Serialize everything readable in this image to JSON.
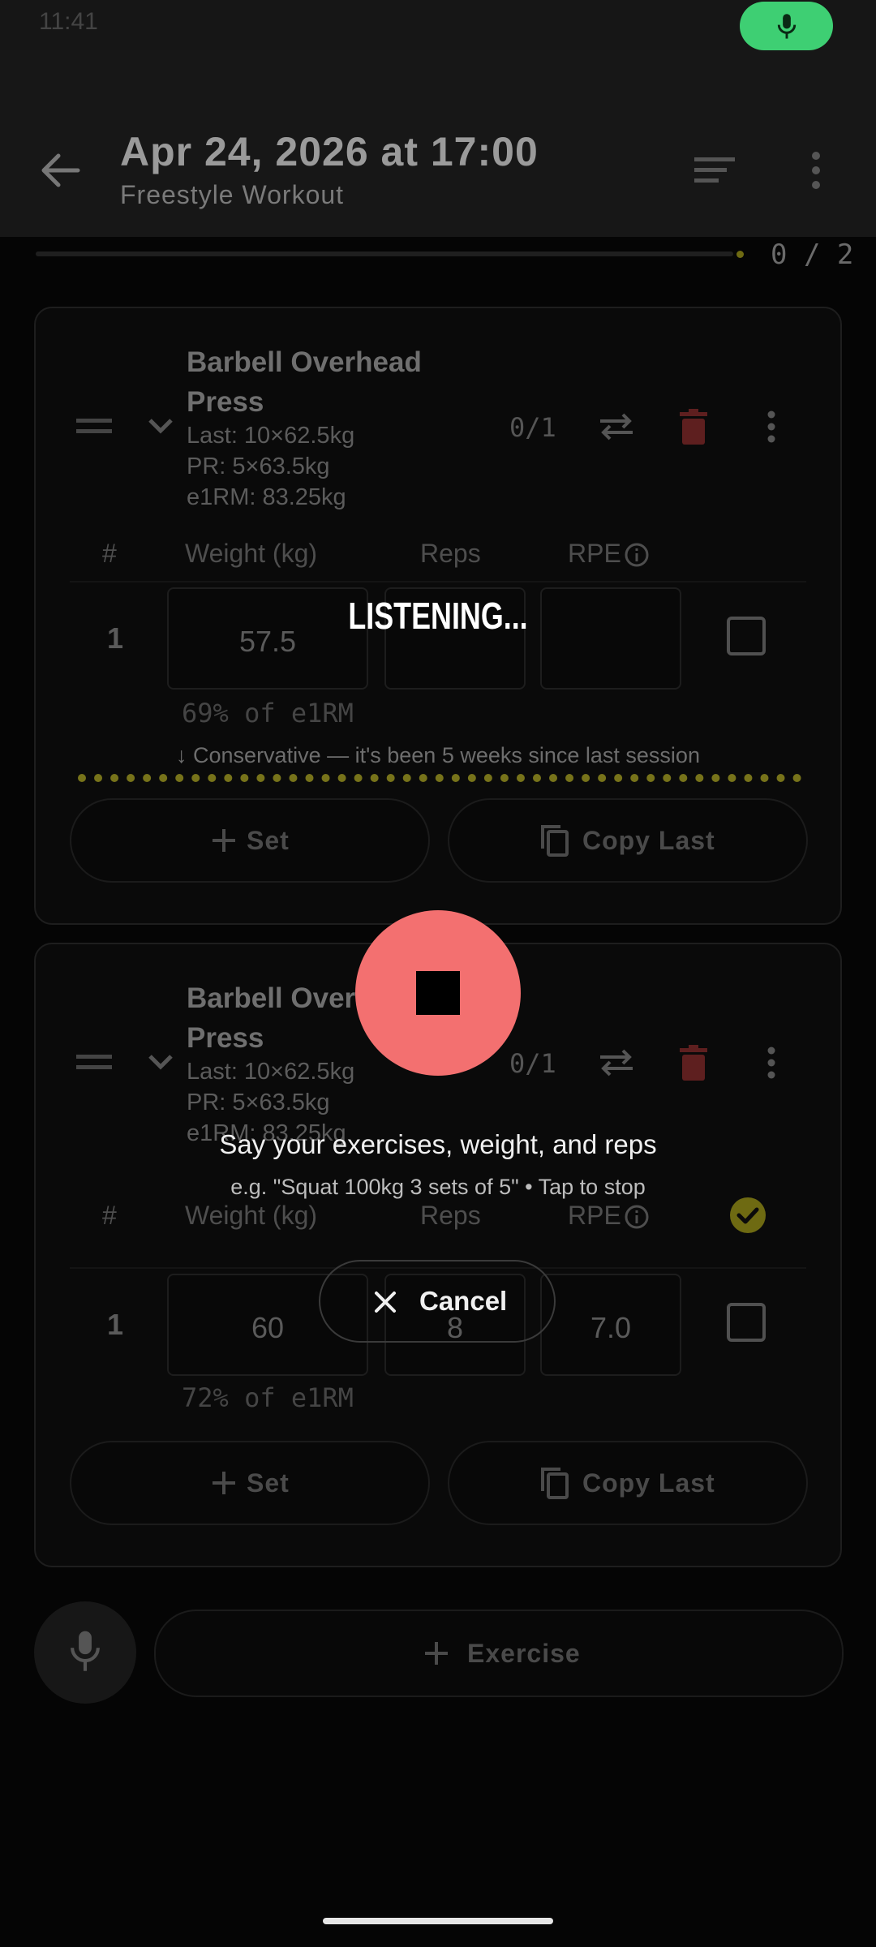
{
  "status_bar": {
    "time": "11:41"
  },
  "header": {
    "title": "Apr 24, 2026 at 17:00",
    "subtitle": "Freestyle Workout",
    "icons": [
      "back-arrow-icon",
      "sort-lines-icon",
      "more-vert-icon"
    ]
  },
  "progress": {
    "text": "0 / 2",
    "value": 0
  },
  "exercises": [
    {
      "name": "Barbell Overhead Press",
      "last": "Last: 10×62.5kg",
      "pr": "PR: 5×63.5kg",
      "e1rm": "e1RM: 83.25kg",
      "set_count": "0/1",
      "headers": {
        "num": "#",
        "weight": "Weight (kg)",
        "reps": "Reps",
        "rpe": "RPE"
      },
      "sets": [
        {
          "num": "1",
          "weight": "57.5",
          "reps": "",
          "rpe": "",
          "pct": "69% of e1RM",
          "done": false
        }
      ],
      "note": "↓ Conservative — it's been 5 weeks since last session",
      "buttons": {
        "add_set": "Set",
        "copy_last": "Copy Last"
      }
    },
    {
      "name": "Barbell Overhead Press",
      "last": "Last: 10×62.5kg",
      "pr": "PR: 5×63.5kg",
      "e1rm": "e1RM: 83.25kg",
      "set_count": "0/1",
      "headers": {
        "num": "#",
        "weight": "Weight (kg)",
        "reps": "Reps",
        "rpe": "RPE"
      },
      "sets": [
        {
          "num": "1",
          "weight": "60",
          "reps": "8",
          "rpe": "7.0",
          "pct": "72% of e1RM",
          "done": false
        }
      ],
      "buttons": {
        "add_set": "Set",
        "copy_last": "Copy Last"
      }
    }
  ],
  "add_exercise_label": "Exercise",
  "overlay": {
    "status": "LISTENING...",
    "instruction": "Say your exercises, weight, and reps",
    "hint": "e.g. \"Squat 100kg 3 sets of 5\"  •  Tap to stop",
    "cancel_label": "Cancel"
  },
  "colors": {
    "accent_green": "#3ecf73",
    "stop_red": "#f37070",
    "delete_red": "#5e1f1f",
    "progress_olive": "#77731a"
  }
}
